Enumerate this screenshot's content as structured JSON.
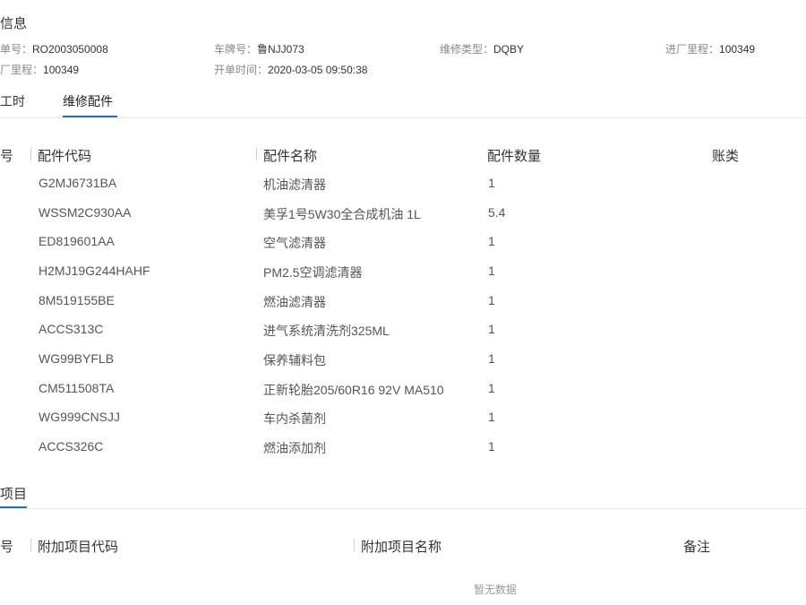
{
  "info": {
    "title": "信息",
    "fields": [
      {
        "label": "单号：",
        "value": "RO2003050008"
      },
      {
        "label": "车牌号：",
        "value": "鲁NJJ073"
      },
      {
        "label": "维修类型：",
        "value": "DQBY"
      },
      {
        "label": "进厂里程：",
        "value": "100349"
      },
      {
        "label": "厂里程：",
        "value": "100349"
      },
      {
        "label": "开单时间：",
        "value": "2020-03-05 09:50:38"
      }
    ]
  },
  "tabs": [
    {
      "label": "工时"
    },
    {
      "label": "维修配件",
      "active": true
    }
  ],
  "parts_table": {
    "headers": [
      "号",
      "配件代码",
      "配件名称",
      "配件数量",
      "账类"
    ],
    "rows": [
      {
        "code": "G2MJ6731BA",
        "name": "机油滤清器",
        "qty": "1"
      },
      {
        "code": "WSSM2C930AA",
        "name": "美孚1号5W30全合成机油 1L",
        "qty": "5.4"
      },
      {
        "code": "ED819601AA",
        "name": "空气滤清器",
        "qty": "1"
      },
      {
        "code": "H2MJ19G244HAHF",
        "name": "PM2.5空调滤清器",
        "qty": "1"
      },
      {
        "code": "8M519155BE",
        "name": "燃油滤清器",
        "qty": "1"
      },
      {
        "code": "ACCS313C",
        "name": "进气系统清洗剂325ML",
        "qty": "1"
      },
      {
        "code": "WG99BYFLB",
        "name": "保养辅料包",
        "qty": "1"
      },
      {
        "code": "CM511508TA",
        "name": "正新轮胎205/60R16 92V MA510",
        "qty": "1"
      },
      {
        "code": "WG999CNSJJ",
        "name": "车内杀菌剂",
        "qty": "1"
      },
      {
        "code": "ACCS326C",
        "name": "燃油添加剂",
        "qty": "1"
      }
    ]
  },
  "extra_section": {
    "title": "项目",
    "headers": [
      "号",
      "附加项目代码",
      "附加项目名称",
      "备注"
    ],
    "empty_text": "暂无数据"
  },
  "colors": {
    "accent": "#1e6fd0"
  }
}
